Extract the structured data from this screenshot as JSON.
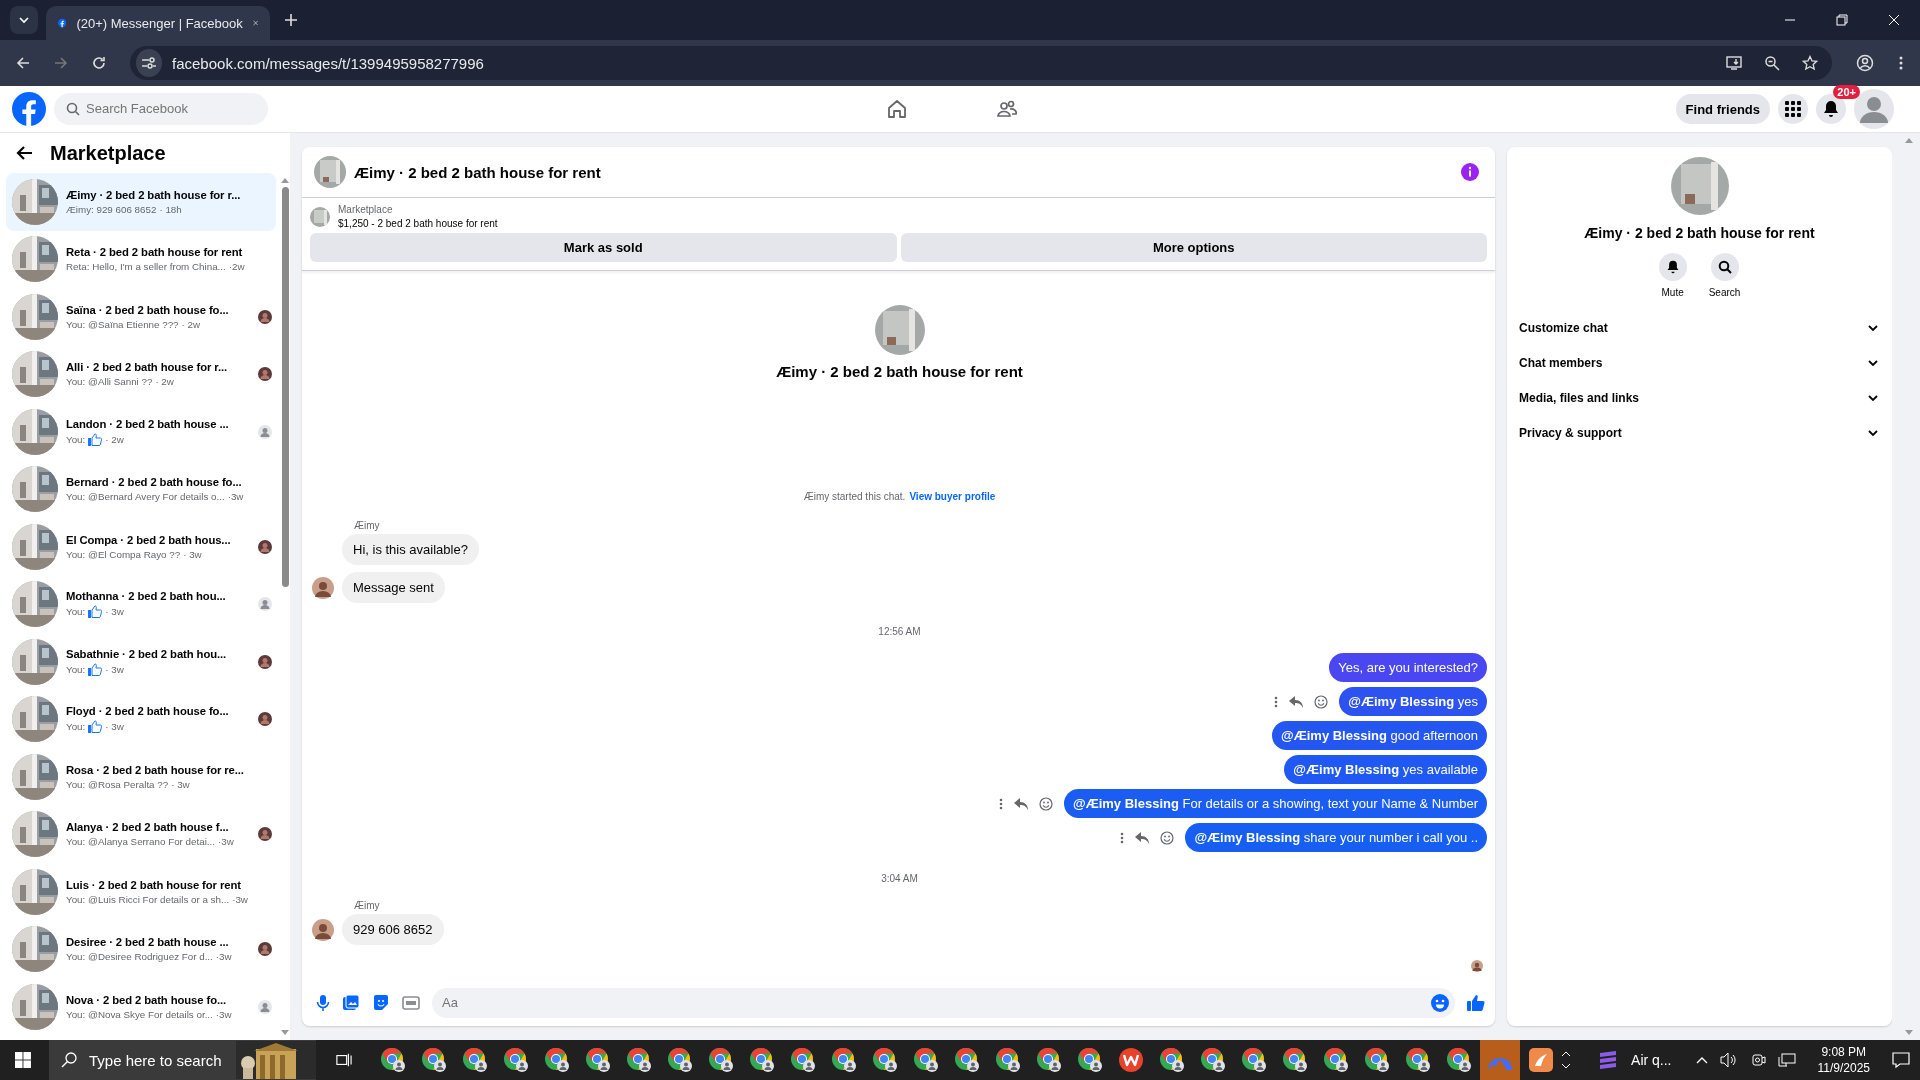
{
  "browser": {
    "tab_title": "(20+) Messenger | Facebook",
    "url": "facebook.com/messages/t/1399495958277996"
  },
  "header": {
    "search": {
      "placeholder": "Search Facebook"
    },
    "find_friends": "Find friends",
    "notification_badge": "20+"
  },
  "sidebar": {
    "title": "Marketplace",
    "items": [
      {
        "title": "Æimy · 2 bed 2 bath house for r...",
        "preview": "Æimy: 929 606 8652",
        "time": "· 18h",
        "like": false,
        "selected": true
      },
      {
        "title": "Reta · 2 bed 2 bath house for rent",
        "preview": "Reta: Hello, I'm a seller from China...",
        "time": "·2w",
        "like": false,
        "selected": false
      },
      {
        "title": "Saïna · 2 bed 2 bath house fo...",
        "preview": "You: @Saïna Etienne ???",
        "time": "· 2w",
        "like": false,
        "selected": false
      },
      {
        "title": "Alli · 2 bed 2 bath house for r...",
        "preview": "You: @Alli Sanni ??",
        "time": "· 2w",
        "like": false,
        "selected": false
      },
      {
        "title": "Landon · 2 bed 2 bath house ...",
        "preview": "You:",
        "time": "· 2w",
        "like": true,
        "selected": false,
        "seen": {
          "kind": "default"
        }
      },
      {
        "title": "Bernard · 2 bed 2 bath house fo...",
        "preview": "You: @Bernard Avery For details o...",
        "time": "·3w",
        "like": false,
        "selected": false
      },
      {
        "title": "El Compa · 2 bed 2 bath hous...",
        "preview": "You: @El Compa Rayo ??",
        "time": "· 3w",
        "like": false,
        "selected": false
      },
      {
        "title": "Mothanna · 2 bed 2 bath hou...",
        "preview": "You:",
        "time": "· 3w",
        "like": true,
        "selected": false,
        "seen": {
          "kind": "default"
        }
      },
      {
        "title": "Sabathnie · 2 bed 2 bath hou...",
        "preview": "You:",
        "time": "· 3w",
        "like": true,
        "selected": false
      },
      {
        "title": "Floyd · 2 bed 2 bath house fo...",
        "preview": "You:",
        "time": "· 3w",
        "like": true,
        "selected": false
      },
      {
        "title": "Rosa · 2 bed 2 bath house for re...",
        "preview": "You: @Rosa Peralta ??",
        "time": "· 3w",
        "like": false,
        "selected": false
      },
      {
        "title": "Alanya · 2 bed 2 bath house f...",
        "preview": "You: @Alanya Serrano For detai...",
        "time": "·3w",
        "like": false,
        "selected": false
      },
      {
        "title": "Luis · 2 bed 2 bath house for rent",
        "preview": "You: @Luis Ricci For details or a sh...",
        "time": "·3w",
        "like": false,
        "selected": false
      },
      {
        "title": "Desiree · 2 bed 2 bath house ...",
        "preview": "You: @Desiree Rodriguez For d...",
        "time": "·3w",
        "like": false,
        "selected": false
      },
      {
        "title": "Nova · 2 bed 2 bath house fo...",
        "preview": "You: @Nova Skye For details or...",
        "time": "·3w",
        "like": false,
        "selected": false,
        "seen": {
          "kind": "default"
        }
      }
    ]
  },
  "chat": {
    "title": "Æimy · 2 bed 2 bath house for rent",
    "listing": {
      "source": "Marketplace",
      "price_title": "$1,250 - 2 bed 2 bath house for rent"
    },
    "buttons": [
      "Mark as sold",
      "More options"
    ],
    "intro_title": "Æimy · 2 bed 2 bath house for rent",
    "started": "Æimy started this chat.",
    "started_link": "View buyer profile",
    "messages": [
      {
        "kind": "sender",
        "text": "Æimy"
      },
      {
        "kind": "incoming",
        "text": "Hi, is this available?",
        "avatar": false
      },
      {
        "kind": "incoming",
        "text": "Message sent",
        "avatar": true
      },
      {
        "kind": "time",
        "text": "12:56 AM"
      },
      {
        "kind": "outgoing",
        "text": "Yes, are you interested?",
        "actions": false,
        "color": "#4a46f2"
      },
      {
        "kind": "outgoing",
        "text": "**@Æimy Blessing** yes",
        "actions": true,
        "color": "#2d52f2"
      },
      {
        "kind": "outgoing",
        "text": "**@Æimy Blessing** good afternoon",
        "actions": false,
        "color": "#2456f2"
      },
      {
        "kind": "outgoing",
        "text": "**@Æimy Blessing** yes available",
        "actions": false,
        "color": "#1f58f2"
      },
      {
        "kind": "outgoing",
        "text": "**@Æimy Blessing** For details or a showing, text your Name & Number",
        "actions": true,
        "color": "#1b5cf2"
      },
      {
        "kind": "outgoing",
        "text": "**@Æimy Blessing** share your number i call you ..",
        "actions": true,
        "color": "#165ff2"
      },
      {
        "kind": "time",
        "text": "3:04 AM"
      },
      {
        "kind": "sender",
        "text": "Æimy"
      },
      {
        "kind": "incoming",
        "text": "929 606 8652",
        "avatar": true
      }
    ],
    "composer": {
      "placeholder": "Aa"
    }
  },
  "details": {
    "title": "Æimy · 2 bed 2 bath house for rent",
    "actions": [
      "Mute",
      "Search"
    ],
    "sections": [
      "Customize chat",
      "Chat members",
      "Media, files and links",
      "Privacy & support"
    ]
  },
  "taskbar": {
    "search": "Type here to search",
    "apps": [
      {
        "kind": "chrome"
      },
      {
        "kind": "chrome"
      },
      {
        "kind": "chrome"
      },
      {
        "kind": "chrome"
      },
      {
        "kind": "chrome"
      },
      {
        "kind": "chrome"
      },
      {
        "kind": "chrome"
      },
      {
        "kind": "chrome"
      },
      {
        "kind": "chrome"
      },
      {
        "kind": "chrome"
      },
      {
        "kind": "chrome"
      },
      {
        "kind": "chrome"
      },
      {
        "kind": "chrome"
      },
      {
        "kind": "chrome"
      },
      {
        "kind": "chrome"
      },
      {
        "kind": "chrome"
      },
      {
        "kind": "chrome"
      },
      {
        "kind": "chrome"
      },
      {
        "kind": "office"
      },
      {
        "kind": "chrome"
      },
      {
        "kind": "chrome"
      },
      {
        "kind": "chrome"
      },
      {
        "kind": "chrome"
      },
      {
        "kind": "chrome"
      },
      {
        "kind": "chrome"
      },
      {
        "kind": "chrome"
      },
      {
        "kind": "chrome"
      },
      {
        "kind": "vpn"
      },
      {
        "kind": "notes"
      }
    ],
    "weather": "Air q...",
    "time": "9:08 PM",
    "date": "11/9/2025"
  }
}
